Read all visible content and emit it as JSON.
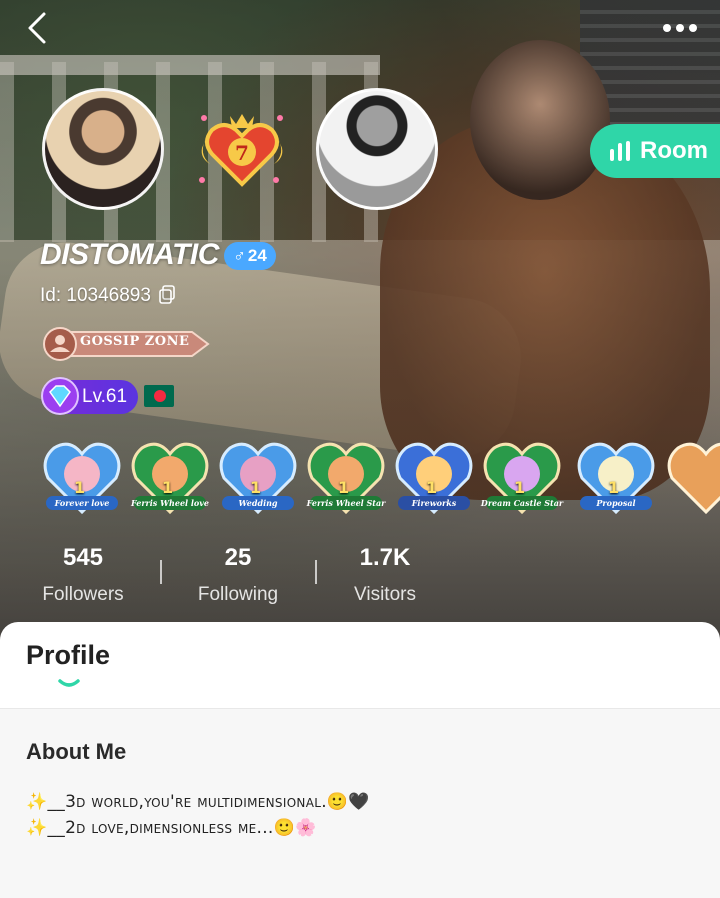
{
  "header": {
    "back_icon": "chevron-left-icon",
    "more_icon": "more-dots-icon"
  },
  "profile": {
    "username": "DISTOMATIC",
    "gender_symbol": "♂",
    "age": "24",
    "id_text": "Id: 10346893",
    "family_tag": "GOSSIP ZONE",
    "level_text": "Lv.61",
    "country_flag": "bangladesh-flag-icon",
    "heart_badge_number": "7"
  },
  "room_button": {
    "label": "Room"
  },
  "medals": [
    {
      "count": "1",
      "caption": "Forever love"
    },
    {
      "count": "1",
      "caption": "Ferris Wheel love"
    },
    {
      "count": "1",
      "caption": "Wedding"
    },
    {
      "count": "1",
      "caption": "Ferris Wheel Star"
    },
    {
      "count": "1",
      "caption": "Fireworks"
    },
    {
      "count": "1",
      "caption": "Dream Castle Star"
    },
    {
      "count": "1",
      "caption": "Proposal"
    }
  ],
  "stats": {
    "followers": {
      "value": "545",
      "label": "Followers"
    },
    "following": {
      "value": "25",
      "label": "Following"
    },
    "visitors": {
      "value": "1.7K",
      "label": "Visitors"
    }
  },
  "tabs": {
    "profile_label": "Profile"
  },
  "about": {
    "title": "About Me",
    "line1": "✨__3d world,you're multidimensional.🙂🖤",
    "line2": "✨__2d love,dimensionless me...🙂🌸"
  },
  "colors": {
    "accent": "#2fd6a8",
    "gender_badge": "#4aa8ff",
    "level_badge": "#6a30dc"
  }
}
